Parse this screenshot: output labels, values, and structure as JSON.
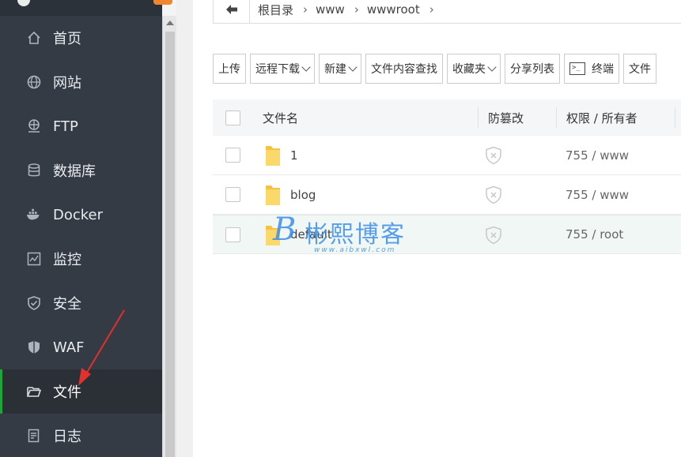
{
  "sidebar": {
    "items": [
      {
        "label": "首页",
        "icon": "home-icon"
      },
      {
        "label": "网站",
        "icon": "globe-icon"
      },
      {
        "label": "FTP",
        "icon": "ftp-icon"
      },
      {
        "label": "数据库",
        "icon": "database-icon"
      },
      {
        "label": "Docker",
        "icon": "docker-icon"
      },
      {
        "label": "监控",
        "icon": "monitor-icon"
      },
      {
        "label": "安全",
        "icon": "shield-icon"
      },
      {
        "label": "WAF",
        "icon": "waf-shield-icon"
      },
      {
        "label": "文件",
        "icon": "folder-open-icon"
      },
      {
        "label": "日志",
        "icon": "log-icon"
      }
    ],
    "active_index": 8
  },
  "breadcrumb": {
    "items": [
      "根目录",
      "www",
      "wwwroot"
    ]
  },
  "toolbar": {
    "upload": "上传",
    "remote_download": "远程下载",
    "new": "新建",
    "content_search": "文件内容查找",
    "favorites": "收藏夹",
    "share_list": "分享列表",
    "terminal": "终端",
    "file_more": "文件"
  },
  "table": {
    "headers": {
      "name": "文件名",
      "tamper": "防篡改",
      "perm": "权限 / 所有者"
    },
    "rows": [
      {
        "name": "1",
        "perm": "755 / www"
      },
      {
        "name": "blog",
        "perm": "755 / www"
      },
      {
        "name": "default",
        "perm": "755 / root"
      }
    ]
  },
  "watermark": {
    "title": "彬熙博客",
    "url": "www.aibxwl.com"
  },
  "colors": {
    "sidebar_bg": "#353b44",
    "active_accent": "#20a53a",
    "folder": "#f7c948",
    "annotation_arrow": "#e0312c"
  }
}
